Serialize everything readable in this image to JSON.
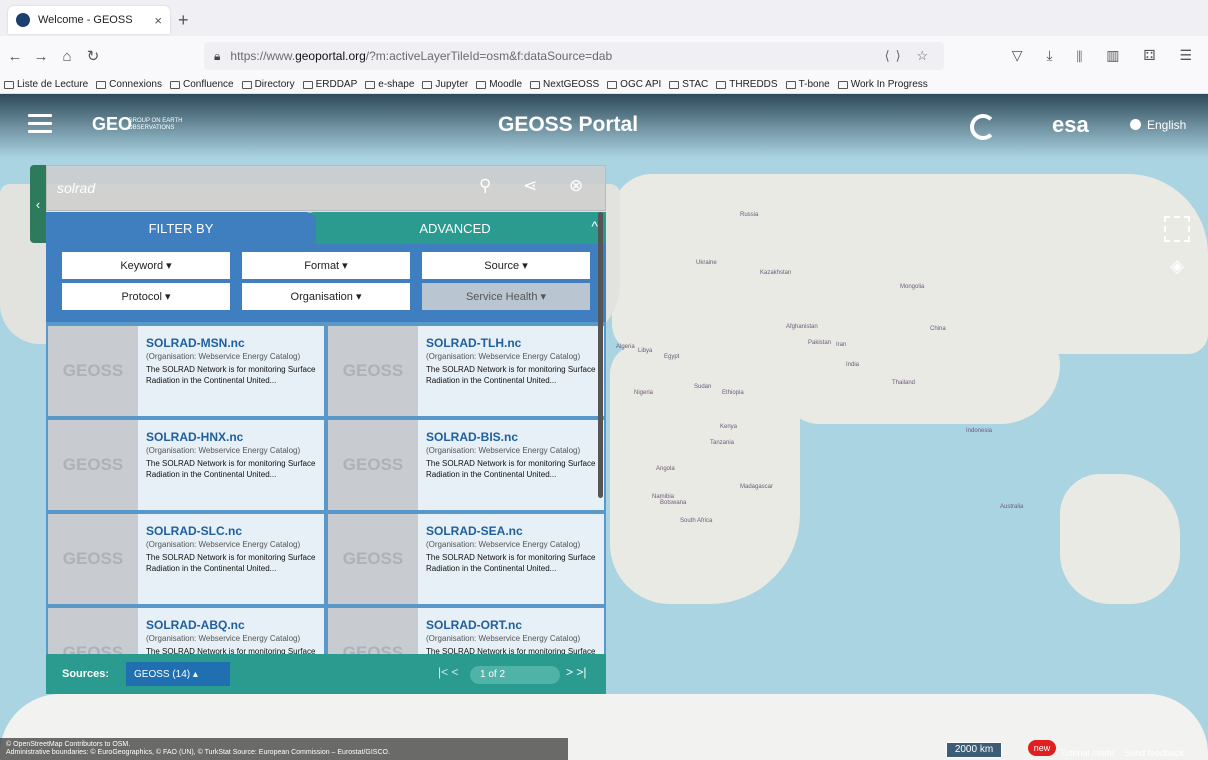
{
  "browser": {
    "tab_title": "Welcome - GEOSS",
    "tab_close": "×",
    "new_tab": "+",
    "url_prefix": "https://www.",
    "url_domain": "geoportal.org",
    "url_path": "/?m:activeLayerTileId=osm&f:dataSource=dab",
    "bookmarks": [
      "Liste de Lecture",
      "Connexions",
      "Confluence",
      "Directory",
      "ERDDAP",
      "e-shape",
      "Jupyter",
      "Moodle",
      "NextGEOSS",
      "OGC API",
      "STAC",
      "THREDDS",
      "T-bone",
      "Work In Progress"
    ]
  },
  "header": {
    "geo_logo": "GEO",
    "geo_sub": "GROUP ON EARTH OBSERVATIONS",
    "portal_title": "GEOSS Portal",
    "esa_logo": "esa",
    "language": "English"
  },
  "search": {
    "query": "solrad",
    "search_icon": "⚲",
    "share_icon": "⋖",
    "clear_icon": "⊗"
  },
  "filter_tabs": {
    "filter_by": "FILTER BY",
    "advanced": "ADVANCED",
    "collapse_arrow": "^"
  },
  "filters": [
    {
      "label": "Keyword ▾"
    },
    {
      "label": "Format ▾"
    },
    {
      "label": "Source ▾"
    },
    {
      "label": "Protocol ▾"
    },
    {
      "label": "Organisation ▾"
    },
    {
      "label": "Service Health ▾"
    }
  ],
  "results": [
    {
      "name": "SOLRAD-MSN.nc",
      "org": "(Organisation: Webservice Energy Catalog)",
      "desc": "The SOLRAD Network is for monitoring Surface Radiation in the Continental United..."
    },
    {
      "name": "SOLRAD-TLH.nc",
      "org": "(Organisation: Webservice Energy Catalog)",
      "desc": "The SOLRAD Network is for monitoring Surface Radiation in the Continental United..."
    },
    {
      "name": "SOLRAD-HNX.nc",
      "org": "(Organisation: Webservice Energy Catalog)",
      "desc": "The SOLRAD Network is for monitoring Surface Radiation in the Continental United..."
    },
    {
      "name": "SOLRAD-BIS.nc",
      "org": "(Organisation: Webservice Energy Catalog)",
      "desc": "The SOLRAD Network is for monitoring Surface Radiation in the Continental United..."
    },
    {
      "name": "SOLRAD-SLC.nc",
      "org": "(Organisation: Webservice Energy Catalog)",
      "desc": "The SOLRAD Network is for monitoring Surface Radiation in the Continental United..."
    },
    {
      "name": "SOLRAD-SEA.nc",
      "org": "(Organisation: Webservice Energy Catalog)",
      "desc": "The SOLRAD Network is for monitoring Surface Radiation in the Continental United..."
    },
    {
      "name": "SOLRAD-ABQ.nc",
      "org": "(Organisation: Webservice Energy Catalog)",
      "desc": "The SOLRAD Network is for monitoring Surface Radiation in the Continental United..."
    },
    {
      "name": "SOLRAD-ORT.nc",
      "org": "(Organisation: Webservice Energy Catalog)",
      "desc": "The SOLRAD Network is for monitoring Surface Radiation in the Continental United..."
    }
  ],
  "thumb_text": "GEOSS",
  "footer": {
    "sources_label": "Sources:",
    "sources_value": "GEOSS (14) ▴",
    "pager_prev": "|< <",
    "page": "1 of 2",
    "pager_next": "> >|"
  },
  "map": {
    "attribution_1": "© OpenStreetMap Contributors to OSM.",
    "attribution_2": "Administrative boundaries: © EuroGeographics, © FAO (UN), © TurkStat Source: European Commission – Eurostat/GISCO.",
    "scale": "2000 km",
    "new_badge": "new",
    "tutorial": "Tutorial mode",
    "feedback": "Send feedback",
    "labels": [
      "Russia",
      "Kazakhstan",
      "Mongolia",
      "China",
      "India",
      "Iran",
      "Egypt",
      "Libya",
      "Algeria",
      "Sudan",
      "Ethiopia",
      "Angola",
      "Nigeria",
      "Australia",
      "Ukraine",
      "Afghanistan",
      "Pakistan",
      "Kenya",
      "Tanzania",
      "Namibia",
      "Botswana",
      "South Africa",
      "Madagascar",
      "Thailand",
      "Indonesia"
    ]
  },
  "colors": {
    "ocean": "#abd4e2",
    "land": "#eaeae4",
    "filter_blue": "#3f7fbf",
    "teal": "#2b9a8f"
  }
}
